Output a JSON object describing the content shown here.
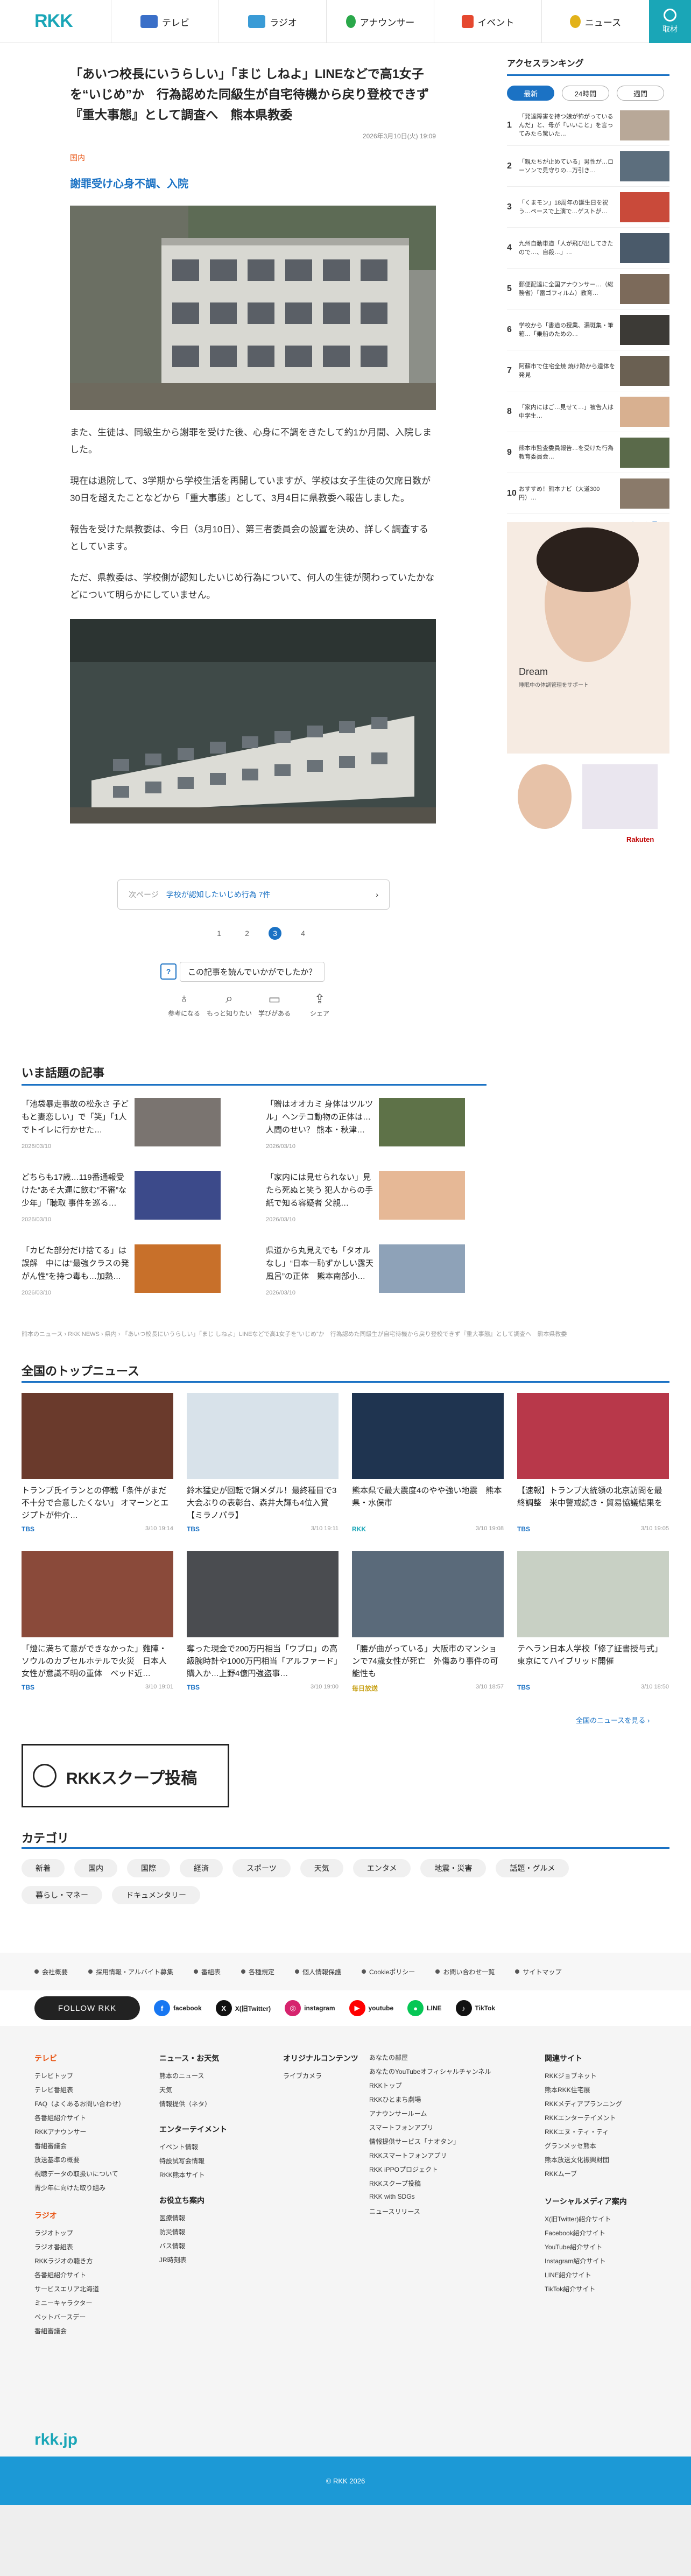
{
  "header": {
    "logo": "RKK",
    "nav": [
      {
        "label": "テレビ",
        "icon": "tv-icon",
        "color": "#3a6fc8"
      },
      {
        "label": "ラジオ",
        "icon": "radio-icon",
        "color": "#3a9bd6"
      },
      {
        "label": "アナウンサー",
        "icon": "announcer-icon",
        "color": "#2aa84a"
      },
      {
        "label": "イベント",
        "icon": "event-flag-icon",
        "color": "#e5482f"
      },
      {
        "label": "ニュース",
        "icon": "news-icon",
        "color": "#e2b21a"
      }
    ],
    "search_label": "取材"
  },
  "article": {
    "title": "「あいつ校長にいうらしい」「まじ しねよ」LINEなどで高1女子を“いじめ”か　行為認めた同級生が自宅待機から戻り登校できず『重大事態』として調査へ　熊本県教委",
    "date": "2026年3月10日(火) 19:09",
    "tag": "国内",
    "subhead": "謝罪受け心身不調、入院",
    "paragraphs": [
      "また、生徒は、同級生から謝罪を受けた後、心身に不調をきたして約1か月間、入院しました。",
      "現在は退院して、3学期から学校生活を再開していますが、学校は女子生徒の欠席日数が30日を超えたことなどから「重大事態」として、3月4日に県教委へ報告しました。",
      "報告を受けた県教委は、今日（3月10日）、第三者委員会の設置を決め、詳しく調査するとしています。",
      "ただ、県教委は、学校側が認知したいじめ行為について、何人の生徒が関わっていたかなどについて明らかにしていません。"
    ],
    "next_page_prefix": "次ページ",
    "next_page_label": "学校が認知したいじめ行為 7件",
    "pages": [
      "1",
      "2",
      "3",
      "4"
    ],
    "current_page": "3",
    "feedback_question": "この記事を読んでいかがでしたか？",
    "reactions": [
      {
        "label": "参考になる",
        "icon": "lightbulb-icon"
      },
      {
        "label": "もっと知りたい",
        "icon": "magnifier-icon"
      },
      {
        "label": "学びがある",
        "icon": "book-icon"
      },
      {
        "label": "シェア",
        "icon": "share-icon"
      }
    ]
  },
  "ranking": {
    "title": "アクセスランキング",
    "tabs": [
      "最新",
      "24時間",
      "週間"
    ],
    "active_tab": "最新",
    "items": [
      {
        "num": "1",
        "text": "「発達障害を持つ娘が怖がっているんだ」と、母が「いいこと」を言ってみたら驚いた…"
      },
      {
        "num": "2",
        "text": "「親たちが止めている」男性が…ローソンで見守りの…万引き…"
      },
      {
        "num": "3",
        "text": "「くまモン」18周年の誕生日を祝う…ペースで上演で…ゲストが…"
      },
      {
        "num": "4",
        "text": "九州自動車道「人が飛び出してきたので…、自殺…」…"
      },
      {
        "num": "5",
        "text": "郵便配達に全国アナウンサー…（総務省）「雷ゴフィルム）教育…"
      },
      {
        "num": "6",
        "text": "学校から「書道の授業、漏斑集・筆箱…「乗船のための…"
      },
      {
        "num": "7",
        "text": "阿蘇市で住宅全焼 焼け跡から遺体を発見"
      },
      {
        "num": "8",
        "text": "「家内にはご…見せて…」被告人は中学生…"
      },
      {
        "num": "9",
        "text": "熊本市監査委員報告…を受けた行為教育委員会…"
      },
      {
        "num": "10",
        "text": "おすすめ！熊本ナビ（大道300円）…"
      }
    ],
    "more": "もっと見る ›"
  },
  "ad": {
    "brand": "Dream",
    "sub": "睡眠中の体調管理をサポート",
    "footer": "Rakuten"
  },
  "trending": {
    "title": "いま話題の記事",
    "items": [
      {
        "title": "「池袋暴走事故の松永さ 子どもと妻恋しい」で「笑」「1人でトイレに行かせた…",
        "date": "2026/03/10"
      },
      {
        "title": "「贈はオオカミ 身体はツルツル」ヘンテコ動物の正体は…人間のせい？ 熊本・秋津…",
        "date": "2026/03/10"
      },
      {
        "title": "どちらも17歳…119番通報受けた“あそ大運に飲む”不審”な少年」「聴取 事件を巡る…",
        "date": "2026/03/10"
      },
      {
        "title": "「家内には見せられない」見たら死ぬと笑う 犯人からの手紙で知る容疑者 父親…",
        "date": "2026/03/10"
      },
      {
        "title": "「カビた部分だけ捨てる」は誤解　中には“最強クラスの発がん性”を持つ毒も…加熱…",
        "date": "2026/03/10"
      },
      {
        "title": "県道から丸見えでも「タオルなし」“日本一恥ずかしい露天風呂”の正体　熊本南部小…",
        "date": "2026/03/10"
      }
    ]
  },
  "breadcrumb": "熊本のニュース › RKK NEWS › 県内 › 「あいつ校長にいうらしい」「まじ しねよ」LINEなどで高1女子を“いじめ”か　行為認めた同級生が自宅待機から戻り登校できず『重大事態』として調査へ　熊本県教委",
  "topnews": {
    "title": "全国のトップニュース",
    "items": [
      {
        "title": "トランプ氏イランとの停戦「条件がまだ不十分で合意したくない」 オマーンとエジプトが仲介…",
        "source": "TBS",
        "date": "3/10 19:14"
      },
      {
        "title": "鈴木猛史が回転で銅メダル！最終種目で3大会ぶりの表彰台、森井大輝も4位入賞【ミラノパラ】",
        "source": "TBS",
        "date": "3/10 19:11"
      },
      {
        "title": "熊本県で最大震度4のやや強い地震　熊本県・水俣市",
        "source": "RKK",
        "date": "3/10 19:08"
      },
      {
        "title": "【速報】トランプ大統領の北京訪問を最終調整　米中警戒続き・貿易協議結果を",
        "source": "TBS",
        "date": "3/10 19:05"
      },
      {
        "title": "「燈に満ちて意ができなかった」難陣・ソウルのカプセルホテルで火災　日本人女性が意識不明の重体　ベッド近…",
        "source": "TBS",
        "date": "3/10 19:01"
      },
      {
        "title": "奪った現金で200万円相当「ウブロ」の高級腕時計や1000万円相当「アルファード」購入か…上野4億円強盗事…",
        "source": "TBS",
        "date": "3/10 19:00"
      },
      {
        "title": "「腰が曲がっている」大阪市のマンションで74歳女性が死亡　外傷あり事件の可能性も",
        "source": "毎日放送",
        "date": "3/10 18:57"
      },
      {
        "title": "テヘラン日本人学校「修了証書授与式」東京にてハイブリッド開催",
        "source": "TBS",
        "date": "3/10 18:50"
      }
    ],
    "more": "全国のニュースを見る ›"
  },
  "scoop": {
    "label": "RKKスクープ投稿"
  },
  "categories": {
    "title": "カテゴリ",
    "row1": [
      "新着",
      "国内",
      "国際",
      "経済",
      "スポーツ",
      "天気",
      "エンタメ",
      "地震・災害",
      "話題・グルメ"
    ],
    "row2": [
      "暮らし・マネー",
      "ドキュメンタリー"
    ]
  },
  "footer": {
    "links": [
      "会社概要",
      "採用情報・アルバイト募集",
      "番組表",
      "各種規定",
      "個人情報保護",
      "Cookieポリシー",
      "お問い合わせ一覧",
      "サイトマップ"
    ],
    "follow": "FOLLOW RKK",
    "social": [
      {
        "label": "facebook",
        "color": "#1877f2",
        "icon": "facebook-icon"
      },
      {
        "label": "X(旧Twitter)",
        "color": "#111111",
        "icon": "x-icon"
      },
      {
        "label": "instagram",
        "color": "#d6246e",
        "icon": "instagram-icon"
      },
      {
        "label": "youtube",
        "color": "#ff0000",
        "icon": "youtube-icon"
      },
      {
        "label": "LINE",
        "color": "#06c755",
        "icon": "line-icon"
      },
      {
        "label": "TikTok",
        "color": "#111111",
        "icon": "tiktok-icon"
      }
    ],
    "cols": [
      {
        "head": "テレビ",
        "orange": true,
        "items": [
          "テレビトップ",
          "テレビ番組表",
          "FAQ（よくあるお問い合わせ）",
          "各番組紹介サイト",
          "RKKアナウンサー",
          "番組審議会",
          "放送基準の概要",
          "視聴データの取扱いについて",
          "青少年に向けた取り組み"
        ]
      },
      {
        "head": "ニュース・お天気",
        "orange": false,
        "items": [
          "熊本のニュース",
          "天気",
          "情報提供（ネタ）"
        ]
      },
      {
        "head": "オリジナルコンテンツ",
        "orange": false,
        "items": [
          "ライブカメラ"
        ]
      },
      {
        "head": "",
        "orange": false,
        "items": [
          "あなたの部屋",
          "あなたのYouTubeオフィシャルチャンネル",
          "RKKトップ",
          "RKKひとまち劇場",
          "アナウンサールーム",
          "スマートフォンアプリ",
          "情報提供サービス「ナオタン」",
          "RKKスマートフォンアプリ",
          "RKK iPPOプロジェクト",
          "RKKスクープ投稿",
          "RKK with SDGs",
          "ニュースリリース"
        ]
      },
      {
        "head": "関連サイト",
        "orange": false,
        "items": [
          "RKKジョブネット",
          "熊本RKK住宅展",
          "RKKメディアプランニング",
          "RKKエンターテイメント",
          "RKKエヌ・ティ・ティ",
          "グランメッセ熊本",
          "熊本放送文化振興財団",
          "RKKムーブ"
        ]
      }
    ],
    "cols2": [
      {
        "head": "エンターテイメント",
        "items": [
          "イベント情報",
          "特設試写会情報",
          "RKK熊本サイト"
        ]
      },
      {
        "head": "お役立ち案内",
        "items": [
          "医療情報",
          "防災情報",
          "バス情報",
          "JR時刻表"
        ]
      },
      {
        "head": "ラジオ",
        "items": [
          "ラジオトップ",
          "ラジオ番組表",
          "RKKラジオの聴き方",
          "各番組紹介サイト",
          "サービスエリア北海道",
          "ミニーキャラクター",
          "ペットバースデー",
          "番組審議会"
        ]
      },
      {
        "head": "ソーシャルメディア案内",
        "items": [
          "X(旧Twitter)紹介サイト",
          "Facebook紹介サイト",
          "YouTube紹介サイト",
          "Instagram紹介サイト",
          "LINE紹介サイト",
          "TikTok紹介サイト"
        ]
      }
    ],
    "logo": "rkk.jp",
    "copyright": "© RKK 2026"
  }
}
